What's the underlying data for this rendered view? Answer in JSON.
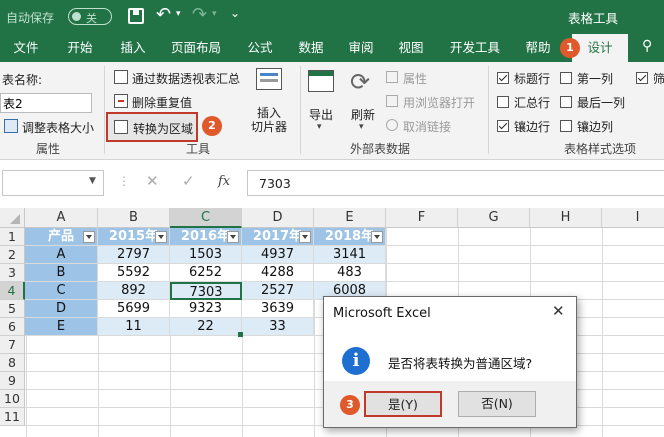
{
  "title_bar": {
    "autosave_label": "自动保存",
    "autosave_state": "关",
    "context_title": "表格工具"
  },
  "tabs": [
    "文件",
    "开始",
    "插入",
    "页面布局",
    "公式",
    "数据",
    "审阅",
    "视图",
    "开发工具",
    "帮助",
    "设计"
  ],
  "active_tab": "设计",
  "ribbon": {
    "properties": {
      "table_name_label": "表名称:",
      "table_name_value": "表2",
      "resize_label": "调整表格大小",
      "group_label": "属性"
    },
    "tools": {
      "pivot_label": "通过数据透视表汇总",
      "remove_dup_label": "删除重复值",
      "convert_label": "转换为区域",
      "slicer_label": "插入\n切片器",
      "group_label": "工具"
    },
    "external": {
      "export_label": "导出",
      "refresh_label": "刷新",
      "props_label": "属性",
      "browser_label": "用浏览器打开",
      "unlink_label": "取消链接",
      "group_label": "外部表数据"
    },
    "style_options": {
      "items": [
        {
          "label": "标题行",
          "checked": true
        },
        {
          "label": "第一列",
          "checked": false
        },
        {
          "label": "筛",
          "checked": true
        },
        {
          "label": "汇总行",
          "checked": false
        },
        {
          "label": "最后一列",
          "checked": false
        },
        {
          "label": "镶边行",
          "checked": true
        },
        {
          "label": "镶边列",
          "checked": false
        }
      ],
      "group_label": "表格样式选项"
    }
  },
  "formula_bar": {
    "name_box": "",
    "fx": "fx",
    "value": "7303"
  },
  "sheet": {
    "columns": [
      "A",
      "B",
      "C",
      "D",
      "E",
      "F",
      "G",
      "H",
      "I"
    ],
    "rows": [
      "1",
      "2",
      "3",
      "4",
      "5",
      "6",
      "7",
      "8",
      "9",
      "10",
      "11"
    ],
    "table_headers": [
      "产品",
      "2015年",
      "2016年",
      "2017年",
      "2018年"
    ],
    "table_rows": [
      [
        "A",
        "2797",
        "1503",
        "4937",
        "3141"
      ],
      [
        "B",
        "5592",
        "6252",
        "4288",
        "483"
      ],
      [
        "C",
        "892",
        "7303",
        "2527",
        "6008"
      ],
      [
        "D",
        "5699",
        "9323",
        "3639",
        ""
      ],
      [
        "E",
        "11",
        "22",
        "33",
        ""
      ]
    ]
  },
  "dialog": {
    "title": "Microsoft Excel",
    "message": "是否将表转换为普通区域?",
    "yes_label": "是(Y)",
    "no_label": "否(N)"
  },
  "badges": [
    "1",
    "2",
    "3"
  ],
  "colors": {
    "excel_green": "#217346",
    "table_header": "#9dc3e6",
    "band_light": "#ddebf7",
    "badge": "#e0592a",
    "highlight_box": "#c0392b"
  }
}
